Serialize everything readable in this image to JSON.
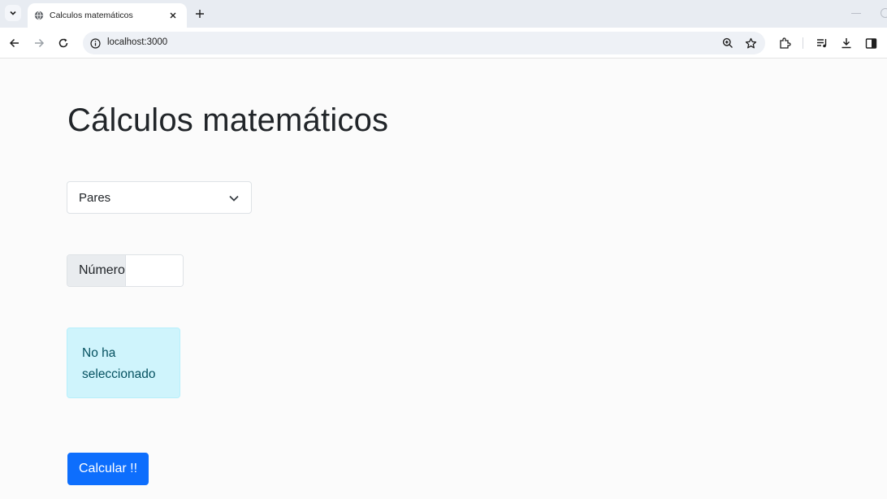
{
  "browser": {
    "tab_title": "Calculos matemáticos",
    "url": "localhost:3000"
  },
  "page": {
    "title": "Cálculos matemáticos",
    "select": {
      "selected": "Pares"
    },
    "number_input": {
      "label": "Número",
      "value": ""
    },
    "alert_text": "No ha seleccionado",
    "calc_button": "Calcular !!"
  },
  "colors": {
    "primary": "#0d6efd",
    "alert_bg": "#cff4fc",
    "alert_text": "#055160",
    "addon_bg": "#e9ecef"
  },
  "icons": [
    "tab-list-icon",
    "globe-icon",
    "close-icon",
    "plus-icon",
    "back-icon",
    "forward-icon",
    "reload-icon",
    "site-info-icon",
    "zoom-icon",
    "star-icon",
    "extensions-icon",
    "media-icon",
    "download-icon",
    "side-panel-icon",
    "chevron-down-icon"
  ]
}
